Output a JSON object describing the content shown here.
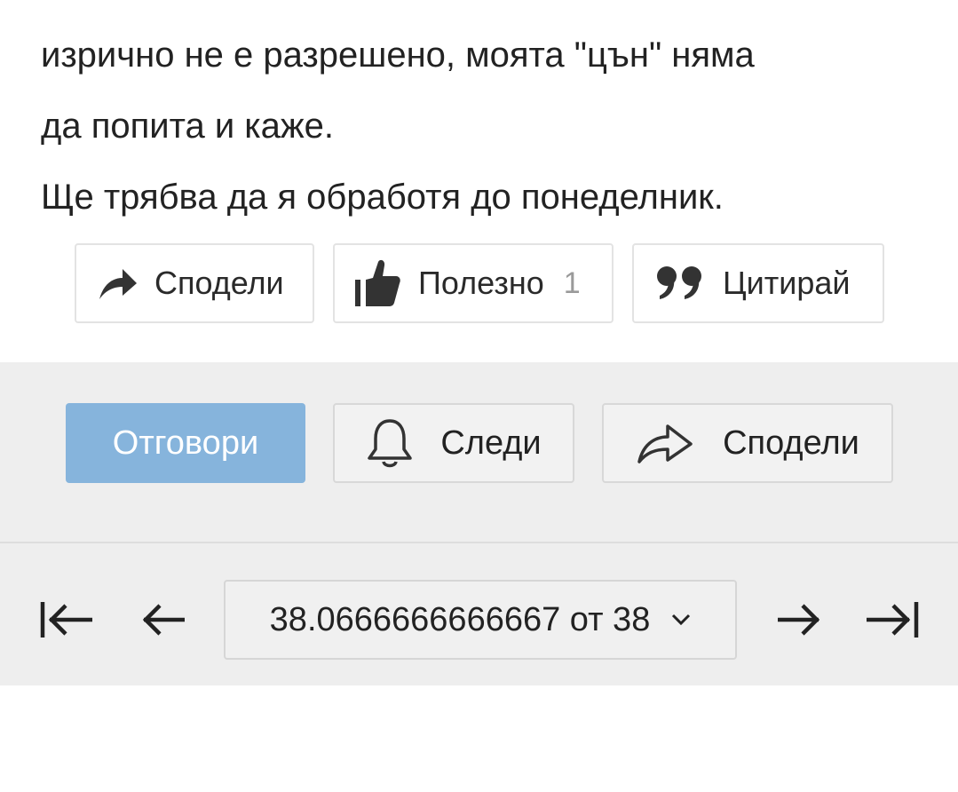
{
  "post": {
    "lines": [
      "изрично не е разрешено, моята \"цън\" няма",
      "да попита и каже.",
      "Ще трябва да я обработя до понеделник."
    ],
    "actions": {
      "share_label": "Сподели",
      "like_label": "Полезно",
      "like_count": "1",
      "quote_label": "Цитирай"
    }
  },
  "thread_actions": {
    "reply_label": "Отговори",
    "follow_label": "Следи",
    "share_label": "Сподели",
    "reply_color": "#86b4dc"
  },
  "pagination": {
    "page_select_text": "38.0666666666667 от 38",
    "icons": [
      "first-page-icon",
      "prev-page-icon",
      "chevron-down-icon",
      "next-page-icon",
      "last-page-icon"
    ]
  }
}
